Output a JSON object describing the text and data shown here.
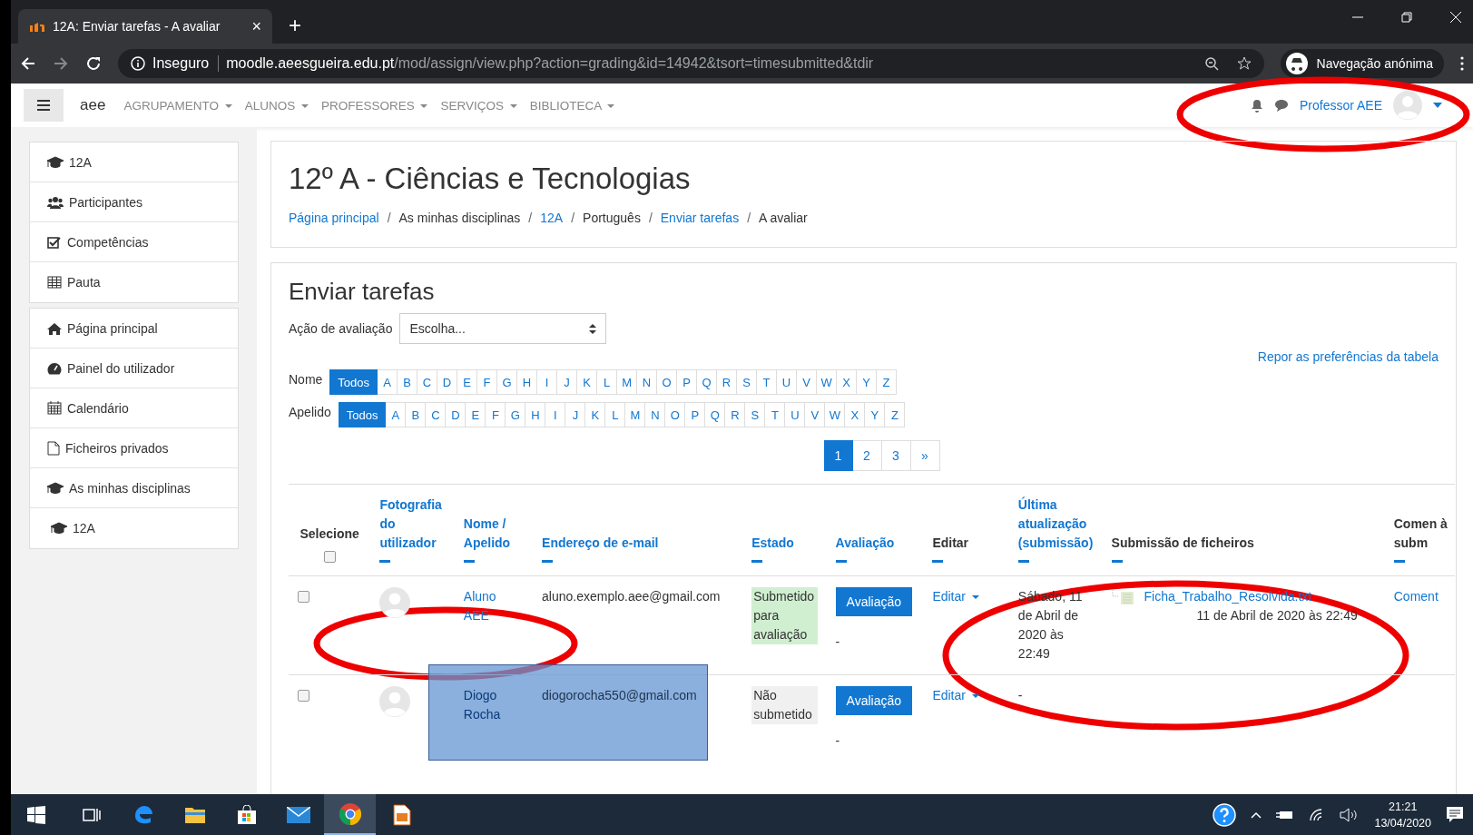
{
  "browser": {
    "tab_title": "12A: Enviar tarefas - A avaliar",
    "tab_close": "×",
    "new_tab": "+",
    "security_label": "Inseguro",
    "url_host": "moodle.aeesgueira.edu.pt",
    "url_path": "/mod/assign/view.php?action=grading&id=14942&tsort=timesubmitted&tdir",
    "profile_label": "Navegação anónima"
  },
  "navbar": {
    "site_name": "aee",
    "menus": [
      {
        "label": "AGRUPAMENTO"
      },
      {
        "label": "ALUNOS"
      },
      {
        "label": "PROFESSORES"
      },
      {
        "label": "SERVIÇOS"
      },
      {
        "label": "BIBLIOTECA"
      }
    ],
    "user_name": "Professor AEE"
  },
  "sidebar": {
    "groups": [
      {
        "items": [
          {
            "kind": "cap",
            "label": "12A"
          },
          {
            "kind": "users",
            "label": "Participantes"
          },
          {
            "kind": "check",
            "label": "Competências"
          },
          {
            "kind": "table",
            "label": "Pauta"
          }
        ]
      },
      {
        "items": [
          {
            "kind": "home",
            "label": "Página principal"
          },
          {
            "kind": "dashboard",
            "label": "Painel do utilizador"
          },
          {
            "kind": "calendar",
            "label": "Calendário"
          },
          {
            "kind": "file",
            "label": "Ficheiros privados"
          },
          {
            "kind": "cap",
            "label": "As minhas disciplinas",
            "children": [
              {
                "kind": "cap",
                "label": "12A"
              }
            ]
          }
        ]
      }
    ]
  },
  "page_header": {
    "title": "12º A - Ciências e Tecnologias",
    "separator": "/",
    "breadcrumb": [
      {
        "label": "Página principal",
        "link": true
      },
      {
        "label": "As minhas disciplinas",
        "link": false
      },
      {
        "label": "12A",
        "link": true
      },
      {
        "label": "Português",
        "link": false
      },
      {
        "label": "Enviar tarefas",
        "link": true
      },
      {
        "label": "A avaliar",
        "link": false
      }
    ]
  },
  "assignment": {
    "heading": "Enviar tarefas",
    "grading_action": {
      "label": "Ação de avaliação",
      "value": "Escolha..."
    },
    "reset_link": "Repor as preferências da tabela",
    "filters": [
      {
        "label": "Nome",
        "options": [
          {
            "label": "Todos",
            "selected": true
          },
          {
            "label": "A",
            "selected": false
          },
          {
            "label": "B",
            "selected": false
          },
          {
            "label": "C",
            "selected": false
          },
          {
            "label": "D",
            "selected": false
          },
          {
            "label": "E",
            "selected": false
          },
          {
            "label": "F",
            "selected": false
          },
          {
            "label": "G",
            "selected": false
          },
          {
            "label": "H",
            "selected": false
          },
          {
            "label": "I",
            "selected": false
          },
          {
            "label": "J",
            "selected": false
          },
          {
            "label": "K",
            "selected": false
          },
          {
            "label": "L",
            "selected": false
          },
          {
            "label": "M",
            "selected": false
          },
          {
            "label": "N",
            "selected": false
          },
          {
            "label": "O",
            "selected": false
          },
          {
            "label": "P",
            "selected": false
          },
          {
            "label": "Q",
            "selected": false
          },
          {
            "label": "R",
            "selected": false
          },
          {
            "label": "S",
            "selected": false
          },
          {
            "label": "T",
            "selected": false
          },
          {
            "label": "U",
            "selected": false
          },
          {
            "label": "V",
            "selected": false
          },
          {
            "label": "W",
            "selected": false
          },
          {
            "label": "X",
            "selected": false
          },
          {
            "label": "Y",
            "selected": false
          },
          {
            "label": "Z",
            "selected": false
          }
        ]
      },
      {
        "label": "Apelido",
        "options": [
          {
            "label": "Todos",
            "selected": true
          },
          {
            "label": "A",
            "selected": false
          },
          {
            "label": "B",
            "selected": false
          },
          {
            "label": "C",
            "selected": false
          },
          {
            "label": "D",
            "selected": false
          },
          {
            "label": "E",
            "selected": false
          },
          {
            "label": "F",
            "selected": false
          },
          {
            "label": "G",
            "selected": false
          },
          {
            "label": "H",
            "selected": false
          },
          {
            "label": "I",
            "selected": false
          },
          {
            "label": "J",
            "selected": false
          },
          {
            "label": "K",
            "selected": false
          },
          {
            "label": "L",
            "selected": false
          },
          {
            "label": "M",
            "selected": false
          },
          {
            "label": "N",
            "selected": false
          },
          {
            "label": "O",
            "selected": false
          },
          {
            "label": "P",
            "selected": false
          },
          {
            "label": "Q",
            "selected": false
          },
          {
            "label": "R",
            "selected": false
          },
          {
            "label": "S",
            "selected": false
          },
          {
            "label": "T",
            "selected": false
          },
          {
            "label": "U",
            "selected": false
          },
          {
            "label": "V",
            "selected": false
          },
          {
            "label": "W",
            "selected": false
          },
          {
            "label": "X",
            "selected": false
          },
          {
            "label": "Y",
            "selected": false
          },
          {
            "label": "Z",
            "selected": false
          }
        ]
      }
    ],
    "pagination": [
      {
        "label": "1",
        "selected": true
      },
      {
        "label": "2",
        "selected": false
      },
      {
        "label": "3",
        "selected": false
      },
      {
        "label": "»",
        "selected": false
      }
    ],
    "table": {
      "select_all_checked": false,
      "columns": [
        {
          "kind": "select",
          "label": "Selecione",
          "link": false
        },
        {
          "kind": "photo",
          "label": "Fotografia do utilizador",
          "link": true
        },
        {
          "kind": "name",
          "label": "Nome / Apelido",
          "link": true
        },
        {
          "kind": "email",
          "label": "Endereço de e-mail",
          "link": true
        },
        {
          "kind": "status",
          "label": "Estado",
          "link": true
        },
        {
          "kind": "grade",
          "label": "Avaliação",
          "link": true
        },
        {
          "kind": "edit",
          "label": "Editar",
          "link": false
        },
        {
          "kind": "modified",
          "label": "Última atualização (submissão)",
          "link": true
        },
        {
          "kind": "files",
          "label": "Submissão de ficheiros",
          "link": false
        },
        {
          "kind": "comments",
          "label": "Comen à subm",
          "link": false
        }
      ],
      "rows": [
        {
          "checked": false,
          "name": "Aluno AEE",
          "email": "aluno.exemplo.aee@gmail.com",
          "status": "Submetido para avaliação",
          "submitted": true,
          "grade_button": "Avaliação",
          "grade": "-",
          "edit": "Editar",
          "last_modified": "Sábado, 11 de Abril de 2020 às 22:49",
          "file_name": "Ficha_Trabalho_Resolvida.txt",
          "file_date": "11 de Abril de 2020 às 22:49",
          "comments": "Coment",
          "redacted": false
        },
        {
          "checked": false,
          "name": "Diogo Rocha",
          "email": "diogorocha550@gmail.com",
          "status": "Não submetido",
          "submitted": false,
          "grade_button": "Avaliação",
          "grade": "-",
          "edit": "Editar",
          "last_modified": "-",
          "redacted": true
        }
      ]
    }
  },
  "annotations": [
    {
      "kind": "ellipse"
    },
    {
      "kind": "ellipse"
    },
    {
      "kind": "ellipse"
    }
  ],
  "taskbar": {
    "apps": [
      {
        "kind": "taskview",
        "active": false
      },
      {
        "kind": "edge",
        "active": false
      },
      {
        "kind": "explorer",
        "active": false
      },
      {
        "kind": "store",
        "active": false
      },
      {
        "kind": "mail",
        "active": false
      },
      {
        "kind": "chrome",
        "active": true
      },
      {
        "kind": "document",
        "active": false
      }
    ],
    "time": "21:21",
    "date": "13/04/2020"
  }
}
